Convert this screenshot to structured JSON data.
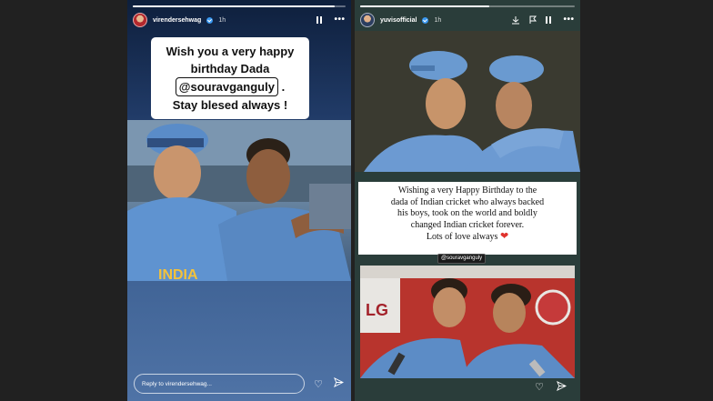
{
  "left_story": {
    "username": "virendersehwag",
    "timestamp": "1h",
    "progress": 0.95,
    "card_lines": [
      "Wish you a very happy",
      "birthday  Dada",
      "@souravganguly",
      ".",
      "Stay blesed always !"
    ],
    "photo_text": "INDIA",
    "reply_placeholder": "Reply to virendersehwag..."
  },
  "right_story": {
    "username": "yuvisofficial",
    "timestamp": "1h",
    "progress": 0.6,
    "caption_lines": [
      "Wishing a very Happy Birthday to the",
      "dada of Indian cricket who always backed",
      "his boys, took on the world and boldly",
      "changed Indian cricket forever.",
      "Lots of love always"
    ],
    "heart": "❤",
    "mention": "@souravganguly",
    "sponsor_logo": "LG"
  },
  "icons": {
    "avatar_left": "avatar-icon",
    "avatar_right": "avatar-icon",
    "verified": "verified-badge-icon",
    "pause": "pause-icon",
    "more": "more-icon",
    "download": "download-icon",
    "report": "report-icon",
    "like": "heart-icon",
    "share": "send-icon"
  }
}
